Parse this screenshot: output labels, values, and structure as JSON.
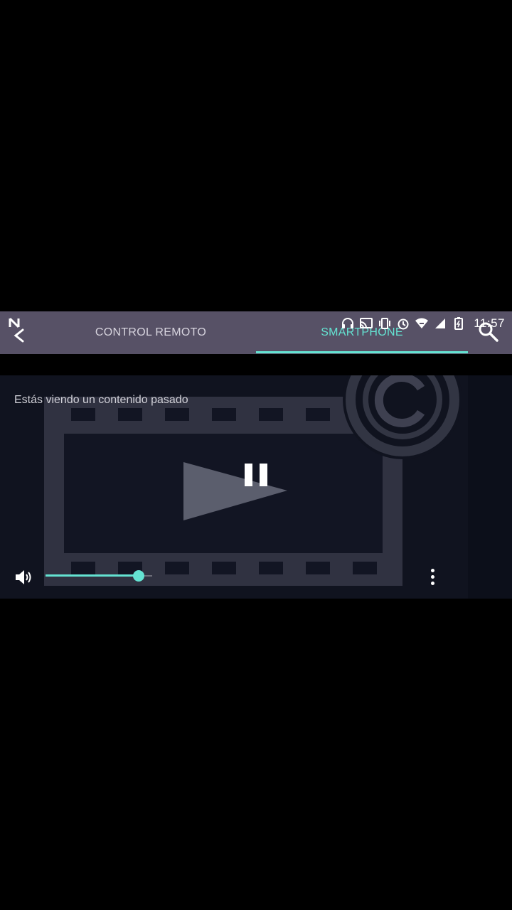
{
  "status_bar": {
    "time": "11:57",
    "icons": [
      "headphones-icon",
      "cast-icon",
      "vibrate-icon",
      "alarm-icon",
      "wifi-icon",
      "signal-icon",
      "battery-charging-icon"
    ]
  },
  "header": {
    "back_icon": "back-arrow-icon",
    "tabs": [
      {
        "label": "CONTROL REMOTO",
        "active": false
      },
      {
        "label": "SMARTPHONE",
        "active": true
      }
    ],
    "search_icon": "search-icon"
  },
  "player": {
    "message": "Estás viendo un contenido pasado",
    "state": "playing",
    "volume_level": 0.87,
    "volume_icon": "volume-icon",
    "menu_icon": "more-vert-icon"
  },
  "colors": {
    "accent": "#64e3d2",
    "header_bg": "#575166",
    "player_bg": "#10131f"
  }
}
